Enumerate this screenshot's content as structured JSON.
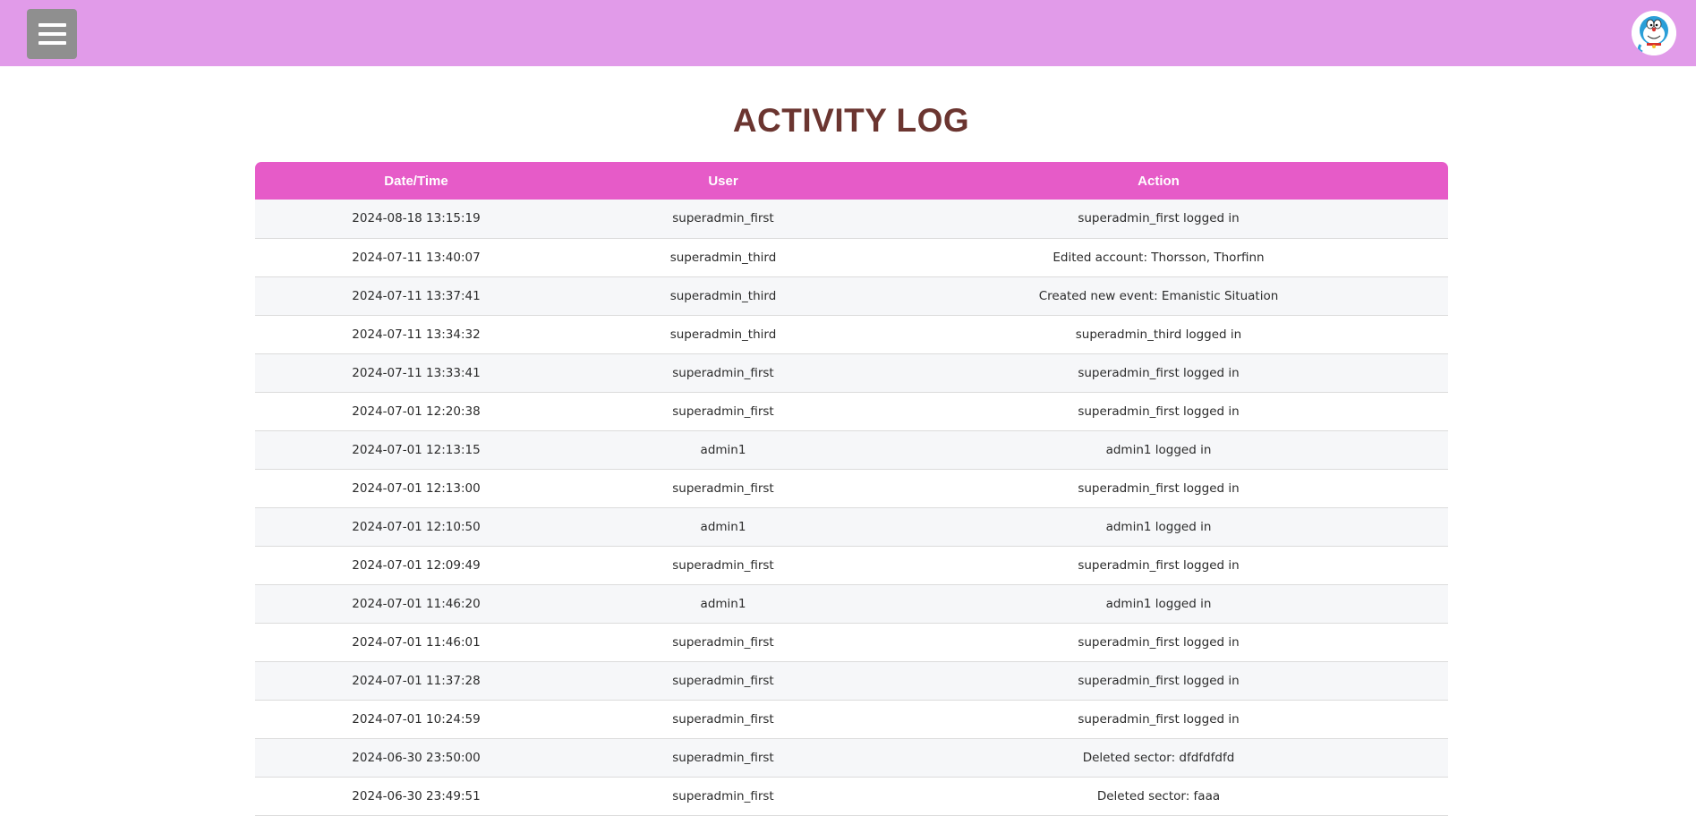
{
  "header": {
    "menu_icon": "hamburger-menu-icon",
    "avatar_icon": "user-avatar-icon"
  },
  "page": {
    "title": "ACTIVITY LOG"
  },
  "colors": {
    "topbar": "#e19be9",
    "table_header": "#e65bc8",
    "title": "#6b3530"
  },
  "table": {
    "columns": [
      "Date/Time",
      "User",
      "Action"
    ],
    "rows": [
      [
        "2024-08-18 13:15:19",
        "superadmin_first",
        "superadmin_first logged in"
      ],
      [
        "2024-07-11 13:40:07",
        "superadmin_third",
        "Edited account: Thorsson, Thorfinn"
      ],
      [
        "2024-07-11 13:37:41",
        "superadmin_third",
        "Created new event: Emanistic Situation"
      ],
      [
        "2024-07-11 13:34:32",
        "superadmin_third",
        "superadmin_third logged in"
      ],
      [
        "2024-07-11 13:33:41",
        "superadmin_first",
        "superadmin_first logged in"
      ],
      [
        "2024-07-01 12:20:38",
        "superadmin_first",
        "superadmin_first logged in"
      ],
      [
        "2024-07-01 12:13:15",
        "admin1",
        "admin1 logged in"
      ],
      [
        "2024-07-01 12:13:00",
        "superadmin_first",
        "superadmin_first logged in"
      ],
      [
        "2024-07-01 12:10:50",
        "admin1",
        "admin1 logged in"
      ],
      [
        "2024-07-01 12:09:49",
        "superadmin_first",
        "superadmin_first logged in"
      ],
      [
        "2024-07-01 11:46:20",
        "admin1",
        "admin1 logged in"
      ],
      [
        "2024-07-01 11:46:01",
        "superadmin_first",
        "superadmin_first logged in"
      ],
      [
        "2024-07-01 11:37:28",
        "superadmin_first",
        "superadmin_first logged in"
      ],
      [
        "2024-07-01 10:24:59",
        "superadmin_first",
        "superadmin_first logged in"
      ],
      [
        "2024-06-30 23:50:00",
        "superadmin_first",
        "Deleted sector: dfdfdfdfd"
      ],
      [
        "2024-06-30 23:49:51",
        "superadmin_first",
        "Deleted sector: faaa"
      ]
    ]
  }
}
